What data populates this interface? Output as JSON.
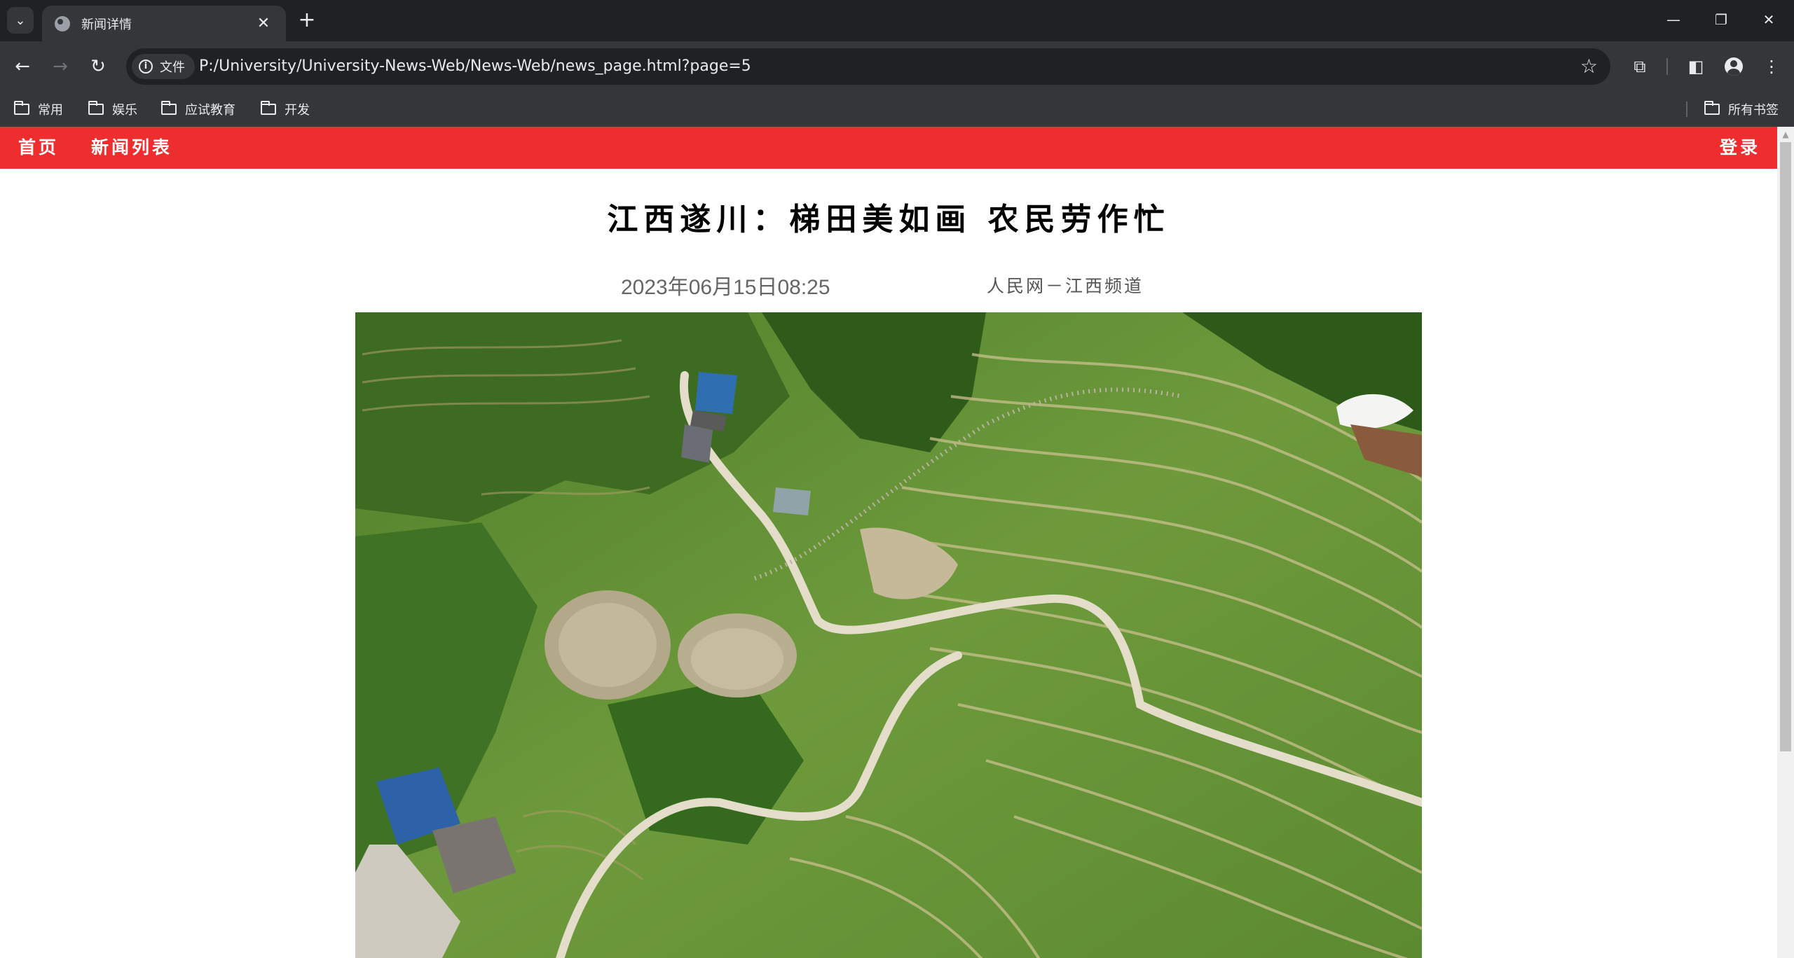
{
  "browser": {
    "tab_title": "新闻详情",
    "address_chip": "文件",
    "url": "P:/University/University-News-Web/News-Web/news_page.html?page=5",
    "bookmarks": [
      "常用",
      "娱乐",
      "应试教育",
      "开发"
    ],
    "all_bookmarks": "所有书签"
  },
  "site_nav": {
    "home": "首页",
    "news_list": "新闻列表",
    "login": "登录"
  },
  "article": {
    "title": "江西遂川：梯田美如画 农民劳作忙",
    "date": "2023年06月15日08:25",
    "source": "人民网－江西频道"
  }
}
